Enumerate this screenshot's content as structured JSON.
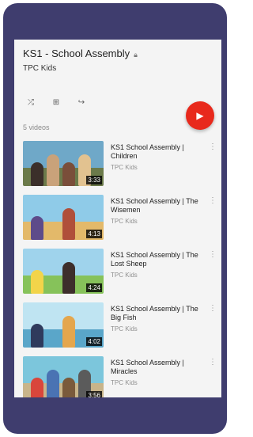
{
  "playlist": {
    "title": "KS1 - School Assembly",
    "channel": "TPC Kids",
    "video_count": "5 videos",
    "privacy_icon": "lock-icon",
    "actions": [
      {
        "name": "shuffle-button",
        "icon": "shuffle-icon",
        "glyph": "⤮"
      },
      {
        "name": "save-to-library-button",
        "icon": "add-to-library-icon",
        "glyph": "⊞"
      },
      {
        "name": "share-button",
        "icon": "share-icon",
        "glyph": "↪"
      }
    ],
    "play_all_icon": "play-icon",
    "accent_color": "#e8291c"
  },
  "videos": [
    {
      "title": "KS1 School Assembly | Children",
      "channel": "TPC Kids",
      "duration": "3:33",
      "sky": "#6fa8c8",
      "ground": "#6b7a4a",
      "figures": [
        "#3b2f2a",
        "#c9a27a",
        "#7a4e3a",
        "#e2c290"
      ]
    },
    {
      "title": "KS1 School Assembly | The Wisemen",
      "channel": "TPC Kids",
      "duration": "4:13",
      "sky": "#8fcbe8",
      "ground": "#e3b96a",
      "figures": [
        "#5e4b8a",
        "#b04f3a"
      ]
    },
    {
      "title": "KS1 School Assembly | The Lost Sheep",
      "channel": "TPC Kids",
      "duration": "4:24",
      "sky": "#9fd3ec",
      "ground": "#86c25a",
      "figures": [
        "#f2d44a",
        "#3d2e2b"
      ]
    },
    {
      "title": "KS1 School Assembly | The Big Fish",
      "channel": "TPC Kids",
      "duration": "4:02",
      "sky": "#bfe4f2",
      "ground": "#5aa6c9",
      "figures": [
        "#2f3a5c",
        "#e4a64d"
      ]
    },
    {
      "title": "KS1 School Assembly | Miracles",
      "channel": "TPC Kids",
      "duration": "3:56",
      "sky": "#7cc6dc",
      "ground": "#c8b48a",
      "figures": [
        "#d9463b",
        "#4a73b3",
        "#7a5a3b",
        "#5b5b5b"
      ]
    }
  ]
}
